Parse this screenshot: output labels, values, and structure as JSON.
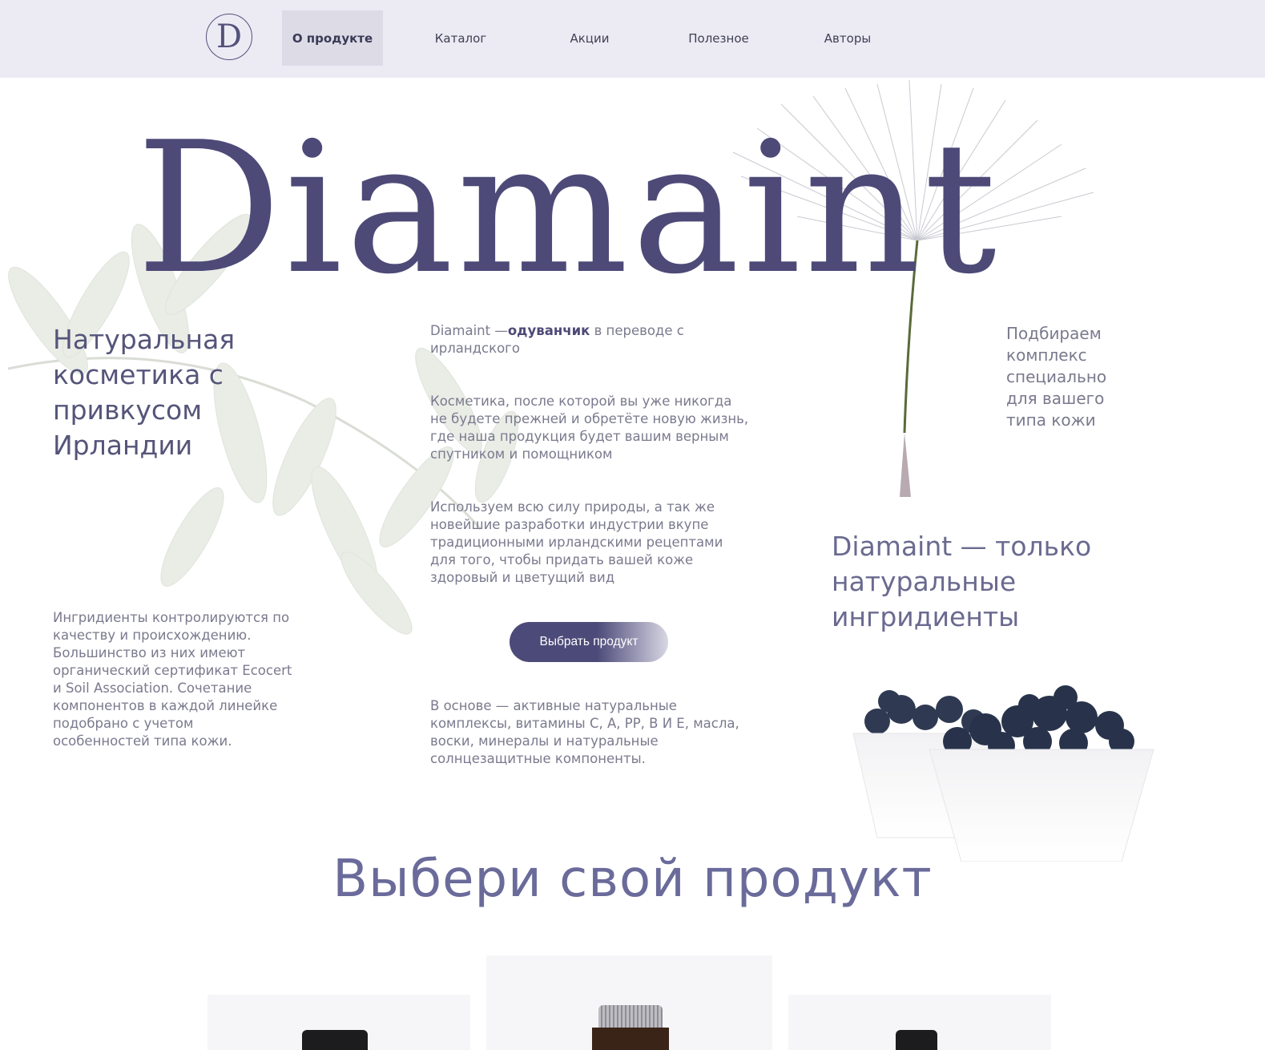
{
  "nav": {
    "logo_letter": "D",
    "items": [
      {
        "label": "О продукте",
        "active": true
      },
      {
        "label": "Каталог",
        "active": false
      },
      {
        "label": "Акции",
        "active": false
      },
      {
        "label": "Полезное",
        "active": false
      },
      {
        "label": "Авторы",
        "active": false
      }
    ]
  },
  "hero": {
    "brand": "Diamaint",
    "tagline": "Натуральная косметика с привкусом Ирландии",
    "meaning_prefix": "Diamaint —",
    "meaning_bold": "одуванчик",
    "meaning_suffix": " в переводе с ирландского",
    "para1": "Косметика, после которой вы уже никогда не будете прежней и обретёте новую жизнь, где наша продукция будет вашим верным спутником и помощником",
    "para2": "Используем всю силу природы, а так же новейшие разработки индустрии вкупе традиционными ирландскими рецептами для того, чтобы придать вашей коже здоровый и цветущий вид",
    "cta": "Выбрать продукт",
    "base": "В основе — активные натуральные комплексы, витамины С, А, РР, В И Е, масла, воски, минералы и натуральные солнцезащитные компоненты.",
    "ingredients": "Ингридиенты контролируются по качеству и происхождению. Большинство из них имеют органический сертификат Ecocert и Soil Association. Сочетание компонентов в каждой линейке подобрано с учетом особенностей типа кожи.",
    "right_small": "Подбираем комплекс специально для вашего типа кожи",
    "right_big": "Diamaint — только натуральные ингридиенты"
  },
  "products": {
    "title": "Выбери свой продукт"
  },
  "colors": {
    "accent": "#4d4a78",
    "header_bg": "#ecebf4",
    "text_muted": "#7a7a8e"
  }
}
